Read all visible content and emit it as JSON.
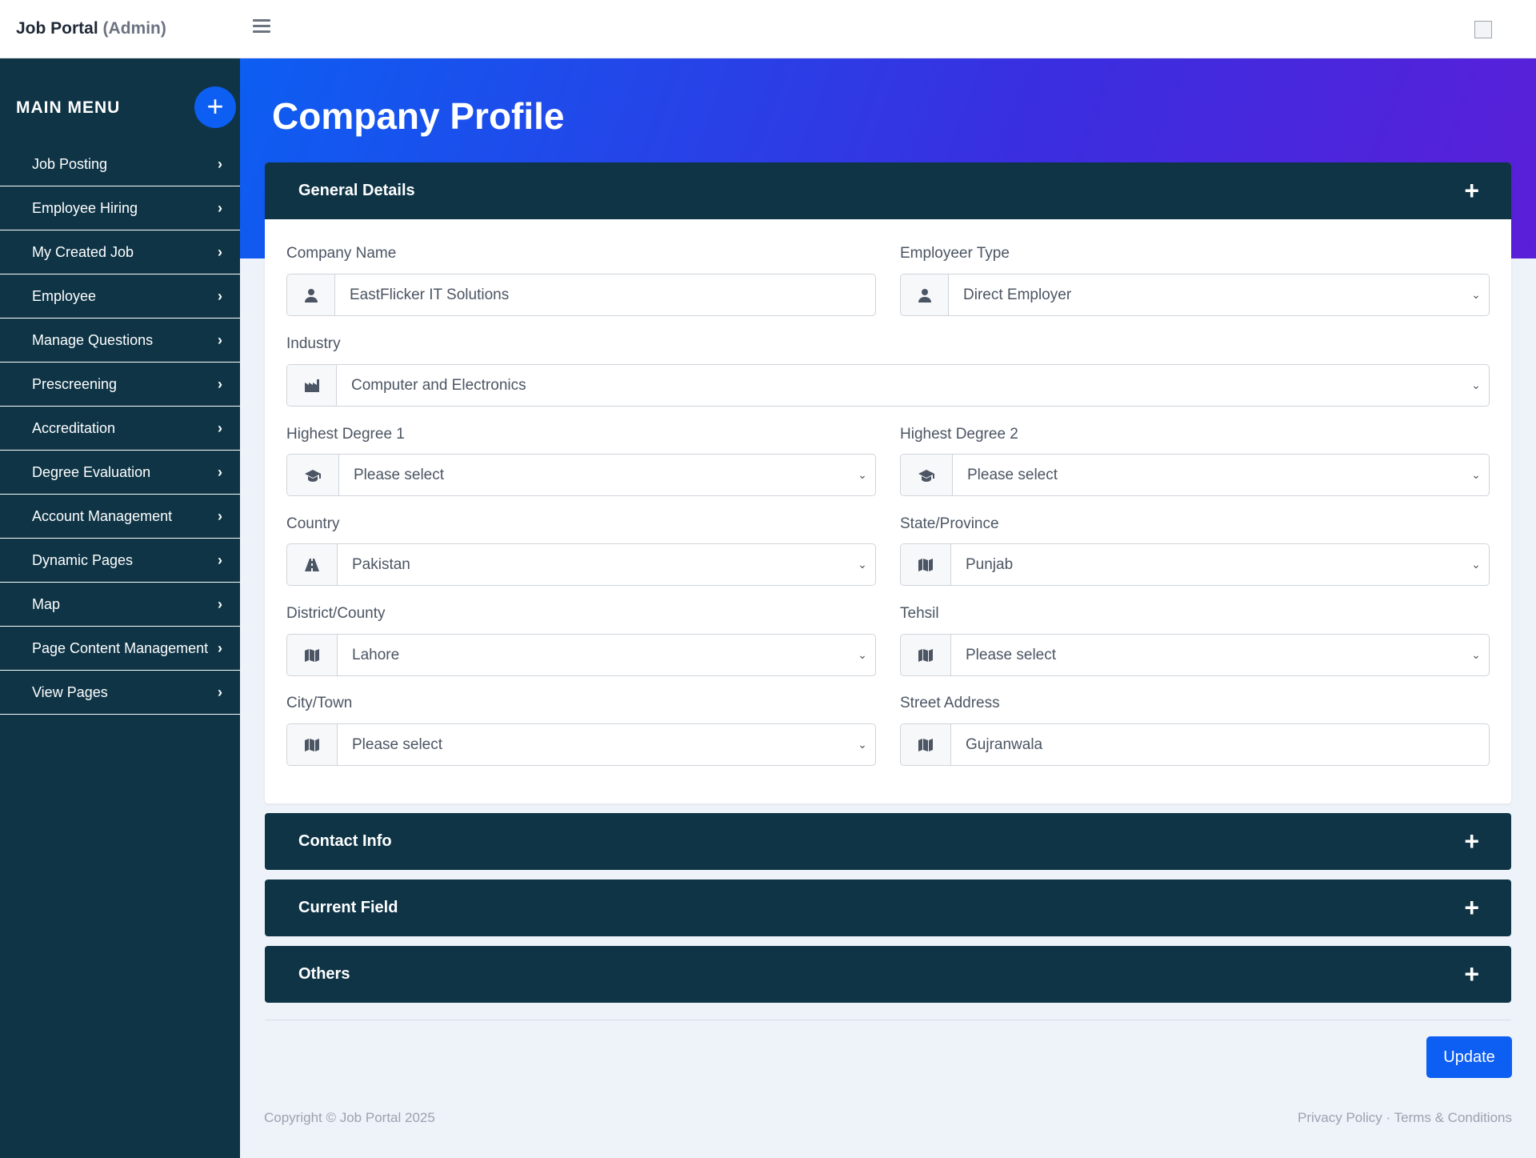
{
  "header": {
    "brand": "Job Portal",
    "role": "(Admin)"
  },
  "sidebar": {
    "title": "MAIN MENU",
    "add_label": "+",
    "items": [
      {
        "label": "Job Posting"
      },
      {
        "label": "Employee Hiring"
      },
      {
        "label": "My Created Job"
      },
      {
        "label": "Employee"
      },
      {
        "label": "Manage Questions"
      },
      {
        "label": "Prescreening"
      },
      {
        "label": "Accreditation"
      },
      {
        "label": "Degree Evaluation"
      },
      {
        "label": "Account Management"
      },
      {
        "label": "Dynamic Pages"
      },
      {
        "label": "Map"
      },
      {
        "label": "Page Content Management"
      },
      {
        "label": "View Pages"
      }
    ]
  },
  "page": {
    "title": "Company Profile"
  },
  "general": {
    "title": "General Details",
    "company_name": {
      "label": "Company Name",
      "value": "EastFlicker IT Solutions"
    },
    "employer_type": {
      "label": "Employeer Type",
      "value": "Direct Employer"
    },
    "industry": {
      "label": "Industry",
      "value": "Computer and Electronics"
    },
    "degree1": {
      "label": "Highest Degree 1",
      "value": "Please select"
    },
    "degree2": {
      "label": "Highest Degree 2",
      "value": "Please select"
    },
    "country": {
      "label": "Country",
      "value": "Pakistan"
    },
    "state": {
      "label": "State/Province",
      "value": "Punjab"
    },
    "district": {
      "label": "District/County",
      "value": "Lahore"
    },
    "tehsil": {
      "label": "Tehsil",
      "value": "Please select"
    },
    "city": {
      "label": "City/Town",
      "value": "Please select"
    },
    "street": {
      "label": "Street Address",
      "value": "Gujranwala"
    }
  },
  "sections": {
    "contact": "Contact Info",
    "current": "Current Field",
    "others": "Others"
  },
  "actions": {
    "update": "Update"
  },
  "footer": {
    "copyright": "Copyright © Job Portal 2025",
    "privacy": "Privacy Policy",
    "separator": " · ",
    "terms": "Terms & Conditions"
  },
  "colors": {
    "sidebar": "#0e3446",
    "accent": "#0d5ef2",
    "banner_end": "#5a1fd8"
  }
}
